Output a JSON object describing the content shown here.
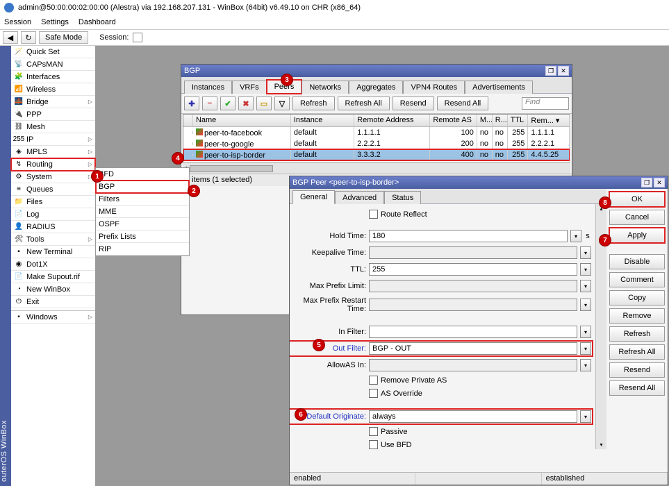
{
  "window_title": "admin@50:00:00:02:00:00 (Alestra) via 192.168.207.131 - WinBox (64bit) v6.49.10 on CHR (x86_64)",
  "menubar": {
    "items": [
      "Session",
      "Settings",
      "Dashboard"
    ]
  },
  "toolbar": {
    "back": "◀",
    "redo": "↻",
    "safe_mode": "Safe Mode",
    "session_label": "Session:"
  },
  "vstrip": "outerOS WinBox",
  "sidebar": {
    "items": [
      {
        "icon": "🪄",
        "label": "Quick Set"
      },
      {
        "icon": "📡",
        "label": "CAPsMAN"
      },
      {
        "icon": "🧩",
        "label": "Interfaces"
      },
      {
        "icon": "📶",
        "label": "Wireless"
      },
      {
        "icon": "🌉",
        "label": "Bridge",
        "sub": true
      },
      {
        "icon": "🔌",
        "label": "PPP"
      },
      {
        "icon": "⛓",
        "label": "Mesh"
      },
      {
        "icon": "255",
        "label": "IP",
        "sub": true
      },
      {
        "icon": "◈",
        "label": "MPLS",
        "sub": true
      },
      {
        "icon": "↯",
        "label": "Routing",
        "sub": true,
        "hl": true
      },
      {
        "icon": "⚙",
        "label": "System",
        "sub": true
      },
      {
        "icon": "≡",
        "label": "Queues"
      },
      {
        "icon": "📁",
        "label": "Files"
      },
      {
        "icon": "📄",
        "label": "Log"
      },
      {
        "icon": "👤",
        "label": "RADIUS"
      },
      {
        "icon": "🛠",
        "label": "Tools",
        "sub": true
      },
      {
        "icon": "▪",
        "label": "New Terminal"
      },
      {
        "icon": "◉",
        "label": "Dot1X"
      },
      {
        "icon": "📄",
        "label": "Make Supout.rif"
      },
      {
        "icon": "◔",
        "label": "New WinBox"
      },
      {
        "icon": "⏻",
        "label": "Exit"
      }
    ],
    "windows": {
      "icon": "▪",
      "label": "Windows",
      "sub": true
    }
  },
  "routing_submenu": [
    "BFD",
    "BGP",
    "Filters",
    "MME",
    "OSPF",
    "Prefix Lists",
    "RIP"
  ],
  "bgp_win": {
    "title": "BGP",
    "tabs": [
      "Instances",
      "VRFs",
      "Peers",
      "Networks",
      "Aggregates",
      "VPN4 Routes",
      "Advertisements"
    ],
    "active_tab": "Peers",
    "toolbar": {
      "add": "✚",
      "del": "−",
      "ok": "✔",
      "x": "✖",
      "note": "▭",
      "filter": "▽",
      "refresh": "Refresh",
      "refresh_all": "Refresh All",
      "resend": "Resend",
      "resend_all": "Resend All",
      "find": "Find"
    },
    "columns": [
      "",
      "Name",
      "Instance",
      "Remote Address",
      "Remote AS",
      "M...",
      "R...",
      "TTL",
      "Rem..."
    ],
    "rows": [
      {
        "name": "peer-to-facebook",
        "instance": "default",
        "addr": "1.1.1.1",
        "as": "100",
        "m": "no",
        "r": "no",
        "ttl": "255",
        "rem": "1.1.1.1"
      },
      {
        "name": "peer-to-google",
        "instance": "default",
        "addr": "2.2.2.1",
        "as": "200",
        "m": "no",
        "r": "no",
        "ttl": "255",
        "rem": "2.2.2.1"
      },
      {
        "name": "peer-to-isp-border",
        "instance": "default",
        "addr": "3.3.3.2",
        "as": "400",
        "m": "no",
        "r": "no",
        "ttl": "255",
        "rem": "4.4.5.25"
      }
    ],
    "status": "3 items (1 selected)"
  },
  "peer_win": {
    "title": "BGP Peer <peer-to-isp-border>",
    "tabs": [
      "General",
      "Advanced",
      "Status"
    ],
    "active_tab": "General",
    "fields": {
      "route_reflect": "Route Reflect",
      "hold_time": {
        "label": "Hold Time:",
        "value": "180",
        "unit": "s"
      },
      "keepalive": {
        "label": "Keepalive Time:",
        "value": ""
      },
      "ttl": {
        "label": "TTL:",
        "value": "255"
      },
      "max_prefix": {
        "label": "Max Prefix Limit:",
        "value": ""
      },
      "max_prefix_restart": {
        "label": "Max Prefix Restart Time:",
        "value": ""
      },
      "in_filter": {
        "label": "In Filter:",
        "value": ""
      },
      "out_filter": {
        "label": "Out Filter:",
        "value": "BGP - OUT"
      },
      "allow_as": {
        "label": "AllowAS In:",
        "value": ""
      },
      "remove_private": "Remove Private AS",
      "as_override": "AS Override",
      "default_originate": {
        "label": "Default Originate:",
        "value": "always"
      },
      "passive": "Passive",
      "use_bfd": "Use BFD"
    },
    "actions": [
      "OK",
      "Cancel",
      "Apply",
      "Disable",
      "Comment",
      "Copy",
      "Remove",
      "Refresh",
      "Refresh All",
      "Resend",
      "Resend All"
    ],
    "status": {
      "left": "enabled",
      "right": "established"
    }
  },
  "annotations": [
    "1",
    "2",
    "3",
    "4",
    "5",
    "6",
    "7",
    "8"
  ]
}
